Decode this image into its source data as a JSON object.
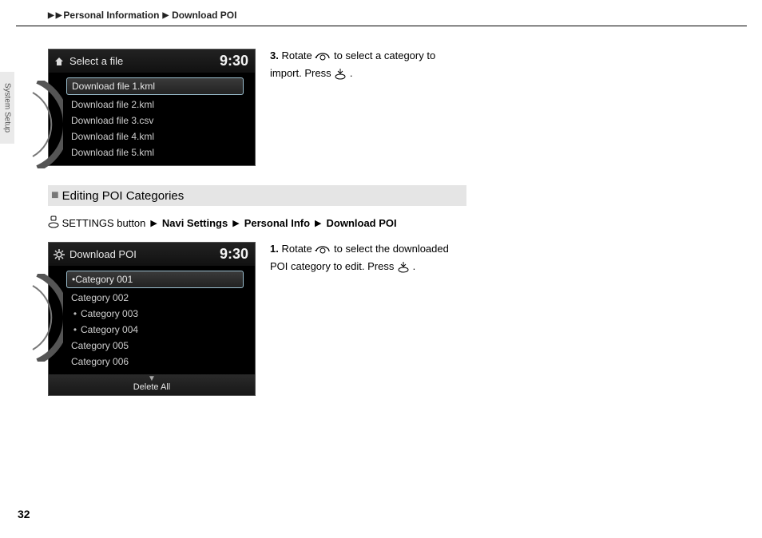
{
  "breadcrumb": {
    "a": "Personal Information",
    "b": "Download POI"
  },
  "sidetab": "System Setup",
  "screen1": {
    "title": "Select a file",
    "clock": "9:30",
    "items": [
      "Download file 1.kml",
      "Download file 2.kml",
      "Download file 3.csv",
      "Download file 4.kml",
      "Download file 5.kml"
    ]
  },
  "step3": {
    "num": "3.",
    "a": "Rotate ",
    "b": " to select a category to import. Press ",
    "c": "."
  },
  "section_title": "Editing POI Categories",
  "navpath": {
    "pre": "SETTINGS button",
    "items": [
      "Navi Settings",
      "Personal Info",
      "Download POI"
    ]
  },
  "screen2": {
    "title": "Download POI",
    "clock": "9:30",
    "items": [
      "Category 001",
      "Category 002",
      "Category 003",
      "Category 004",
      "Category 005",
      "Category 006"
    ],
    "bottom": "Delete All"
  },
  "step1b": {
    "num": "1.",
    "a": "Rotate ",
    "b": " to select the downloaded POI category to edit. Press ",
    "c": "."
  },
  "page_number": "32"
}
